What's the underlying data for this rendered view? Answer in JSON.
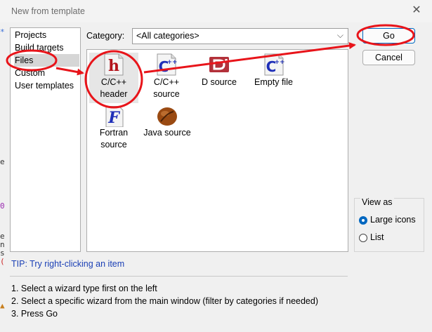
{
  "window": {
    "title": "New from template",
    "close_glyph": "✕"
  },
  "categories_list": [
    "Projects",
    "Build targets",
    "Files",
    "Custom",
    "User templates"
  ],
  "category": {
    "label": "Category:",
    "selected": "<All categories>"
  },
  "templates": [
    {
      "label_1": "C/C++",
      "label_2": "header",
      "icon": "c-cpp-header-icon"
    },
    {
      "label_1": "C/C++",
      "label_2": "source",
      "icon": "c-cpp-source-icon"
    },
    {
      "label_1": "D source",
      "label_2": "",
      "icon": "d-source-icon"
    },
    {
      "label_1": "Empty file",
      "label_2": "",
      "icon": "empty-file-icon"
    },
    {
      "label_1": "Fortran",
      "label_2": "source",
      "icon": "fortran-source-icon"
    },
    {
      "label_1": "Java source",
      "label_2": "",
      "icon": "java-source-icon"
    }
  ],
  "buttons": {
    "go": "Go",
    "cancel": "Cancel"
  },
  "view_as": {
    "legend": "View as",
    "options": [
      "Large icons",
      "List"
    ],
    "selected": "Large icons"
  },
  "tip": "TIP: Try right-clicking an item",
  "instructions": [
    "1. Select a wizard type first on the left",
    "2. Select a specific wizard from the main window (filter by categories if needed)",
    "3. Press Go"
  ],
  "colors": {
    "annotation": "#e8141a",
    "accent": "#0067c0",
    "tip_text": "#1a3fb5"
  }
}
